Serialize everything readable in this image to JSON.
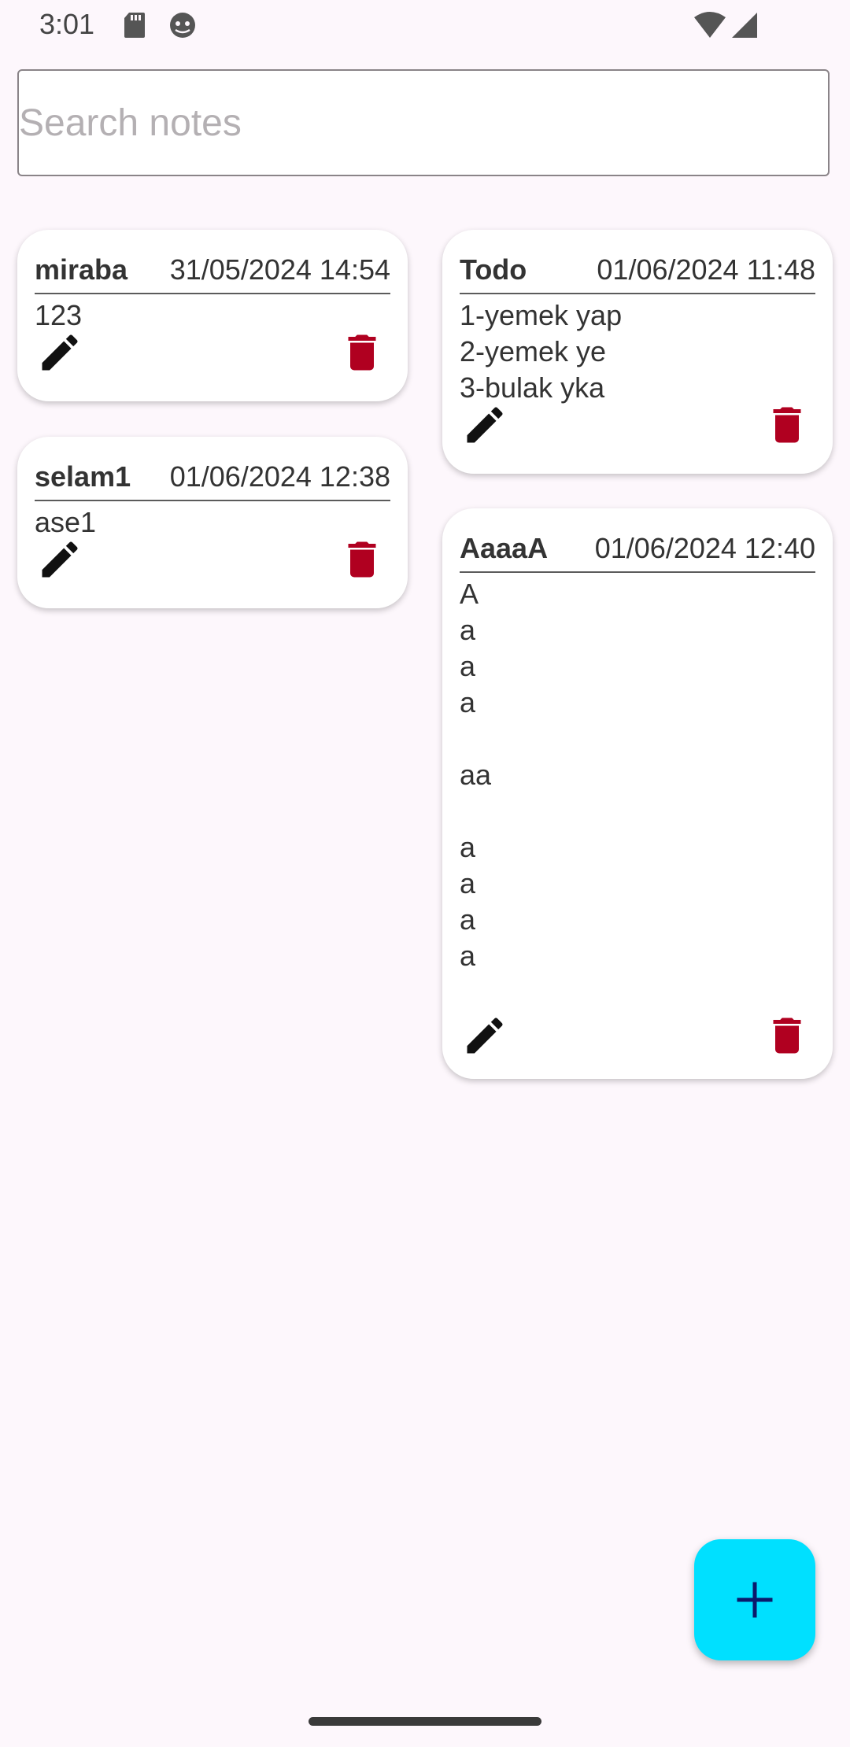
{
  "status_bar": {
    "time": "3:01",
    "icons_left": [
      "sd-card-icon",
      "android-debug-icon"
    ],
    "icons_right": [
      "wifi-icon",
      "cellular-signal-icon"
    ]
  },
  "search": {
    "placeholder": "Search notes",
    "value": ""
  },
  "notes": [
    {
      "title": "miraba",
      "date": "31/05/2024 14:54",
      "content": "123"
    },
    {
      "title": "Todo",
      "date": "01/06/2024 11:48",
      "content": "1-yemek yap\n2-yemek ye\n3-bulak yka"
    },
    {
      "title": "selam1",
      "date": "01/06/2024 12:38",
      "content": "ase1"
    },
    {
      "title": "AaaaA",
      "date": "01/06/2024 12:40",
      "content": "A\na\na\na\n\naa\n\na\na\na\na"
    }
  ],
  "actions": {
    "edit_icon": "pencil-icon",
    "delete_icon": "trash-icon",
    "add_icon": "plus-icon"
  },
  "colors": {
    "background": "#fdf7fc",
    "card": "#ffffff",
    "delete": "#b00020",
    "fab": "#00e0ff",
    "fab_icon": "#0b1a6b"
  }
}
